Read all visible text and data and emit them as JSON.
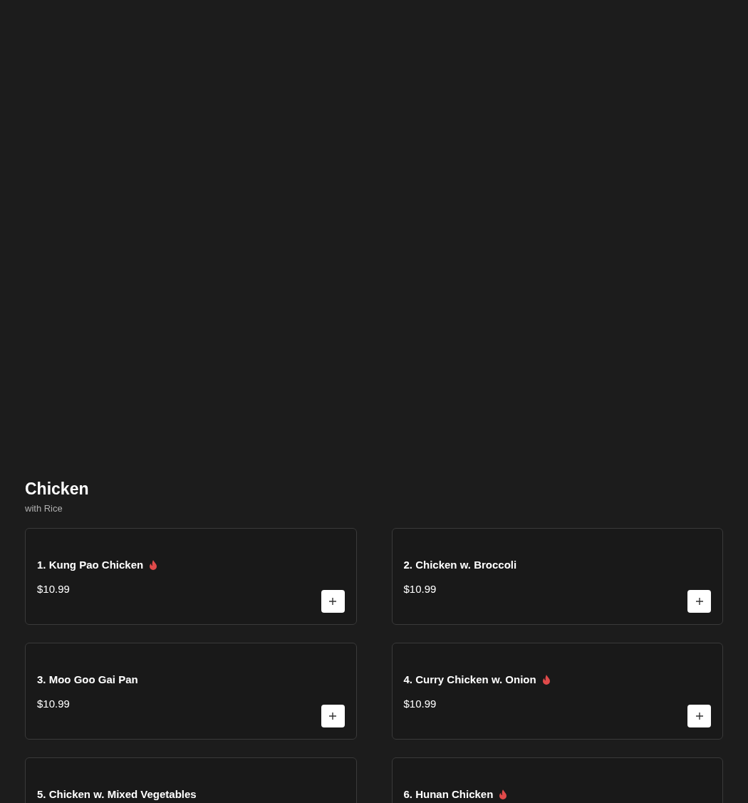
{
  "section": {
    "title": "Chicken",
    "subtitle": "with Rice"
  },
  "items": [
    {
      "name": "1. Kung Pao Chicken",
      "spicy": true,
      "price": "$10.99"
    },
    {
      "name": "2. Chicken w. Broccoli",
      "spicy": false,
      "price": "$10.99"
    },
    {
      "name": "3. Moo Goo Gai Pan",
      "spicy": false,
      "price": "$10.99"
    },
    {
      "name": "4. Curry Chicken w. Onion",
      "spicy": true,
      "price": "$10.99"
    },
    {
      "name": "5. Chicken w. Mixed Vegetables",
      "spicy": false
    },
    {
      "name": "6. Hunan Chicken",
      "spicy": true
    }
  ]
}
